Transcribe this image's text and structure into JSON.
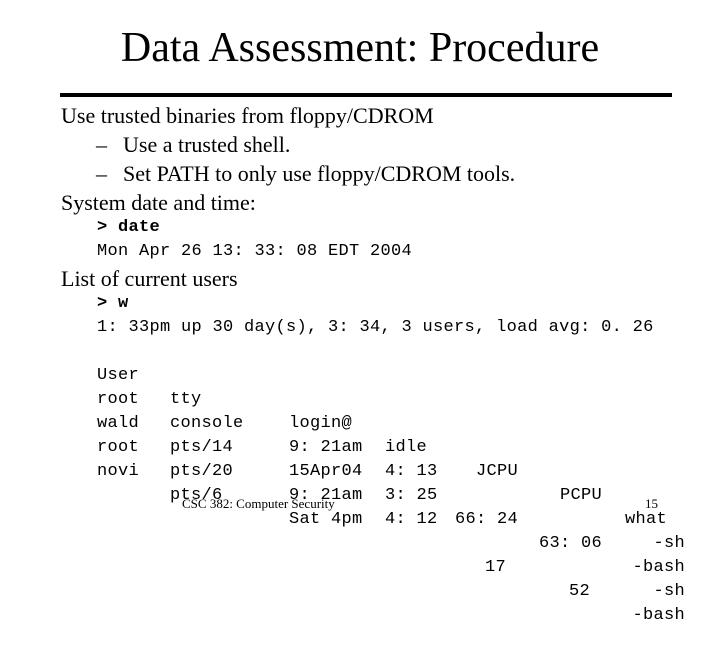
{
  "slide": {
    "title": "Data Assessment: Procedure",
    "bullets": [
      {
        "level": 1,
        "text": "Use trusted binaries from floppy/CDROM"
      },
      {
        "level": 2,
        "marker": "–",
        "text": "Use a trusted shell."
      },
      {
        "level": 2,
        "marker": "–",
        "text": "Set PATH to only use floppy/CDROM tools."
      },
      {
        "level": 1,
        "text": "System date and time:"
      }
    ],
    "date_command": "> date",
    "date_output": "Mon Apr 26 13: 33: 08 EDT 2004",
    "users_heading": "List of current users",
    "w_command": "> w",
    "w_summary": "1: 33pm up 30 day(s), 3: 34, 3 users, load avg: 0. 26",
    "w_table": {
      "headers": [
        "User",
        "tty",
        "login@",
        "idle",
        "JCPU",
        "PCPU",
        "what"
      ],
      "rows": [
        [
          "root",
          "console",
          "9: 21am",
          "4: 13",
          "",
          "",
          "-sh"
        ],
        [
          "wald",
          "pts/14",
          "15Apr04",
          "3: 25",
          "66: 24",
          "63: 06",
          "-bash"
        ],
        [
          "root",
          "pts/20",
          "9: 21am",
          "4: 12",
          "",
          "",
          "-sh"
        ],
        [
          "novi",
          "pts/6",
          "Sat 4pm",
          "",
          "17",
          "52",
          "-bash"
        ]
      ]
    },
    "footer": {
      "course": "CSC 382: Computer Security",
      "page_number": "15"
    }
  }
}
